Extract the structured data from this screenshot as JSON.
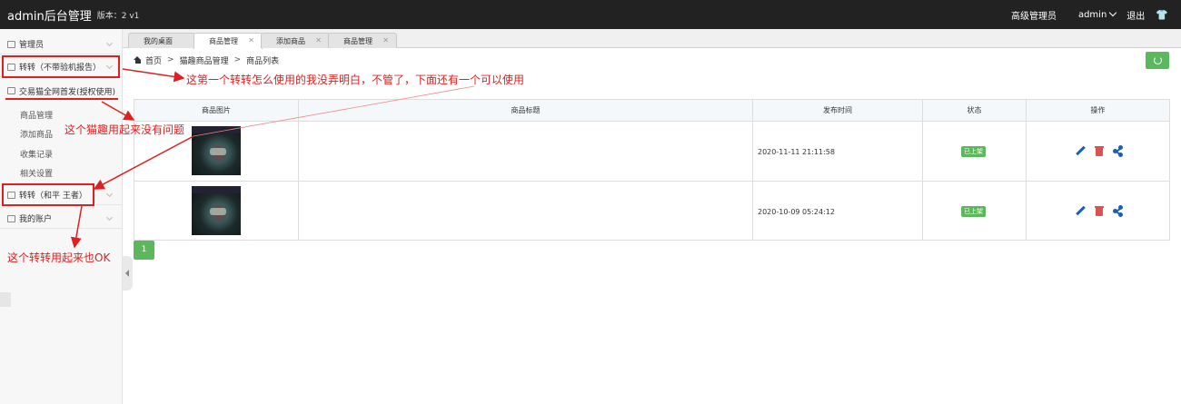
{
  "topbar": {
    "brand": "admin后台管理",
    "version": "版本：2 v1",
    "role": "高级管理员",
    "user": "admin",
    "logout": "退出"
  },
  "sidebar": {
    "items": [
      {
        "label": "管理员"
      },
      {
        "label": "转转（不带验机报告）"
      },
      {
        "label": "交易猫全网首发(授权使用)"
      },
      {
        "label": "转转（和平 王者）"
      },
      {
        "label": "我的账户"
      }
    ],
    "submenu": [
      "商品管理",
      "添加商品",
      "收集记录",
      "相关设置"
    ]
  },
  "tabs": [
    {
      "label": "我的桌面"
    },
    {
      "label": "商品管理"
    },
    {
      "label": "添加商品"
    },
    {
      "label": "商品管理"
    }
  ],
  "breadcrumb": {
    "home": "首页",
    "level1": "猫趣商品管理",
    "level2": "商品列表"
  },
  "table": {
    "headers": [
      "商品图片",
      "商品标题",
      "发布时间",
      "状态",
      "操作"
    ],
    "rows": [
      {
        "title": "",
        "time": "2020-11-11 21:11:58",
        "status": "已上架"
      },
      {
        "title": "",
        "time": "2020-10-09 05:24:12",
        "status": "已上架"
      }
    ]
  },
  "pagination": {
    "current": "1"
  },
  "annotations": {
    "note1": "这第一个转转怎么使用的我没弄明白，不管了，下面还有一个可以使用",
    "note2": "这个猫趣用起来没有问题",
    "note3": "这个转转用起来也OK"
  },
  "colors": {
    "topbar": "#222222",
    "accent_green": "#5cb85c",
    "annotation_red": "#e02020",
    "edit_blue": "#1a5fb4",
    "delete_red": "#d9534f"
  }
}
